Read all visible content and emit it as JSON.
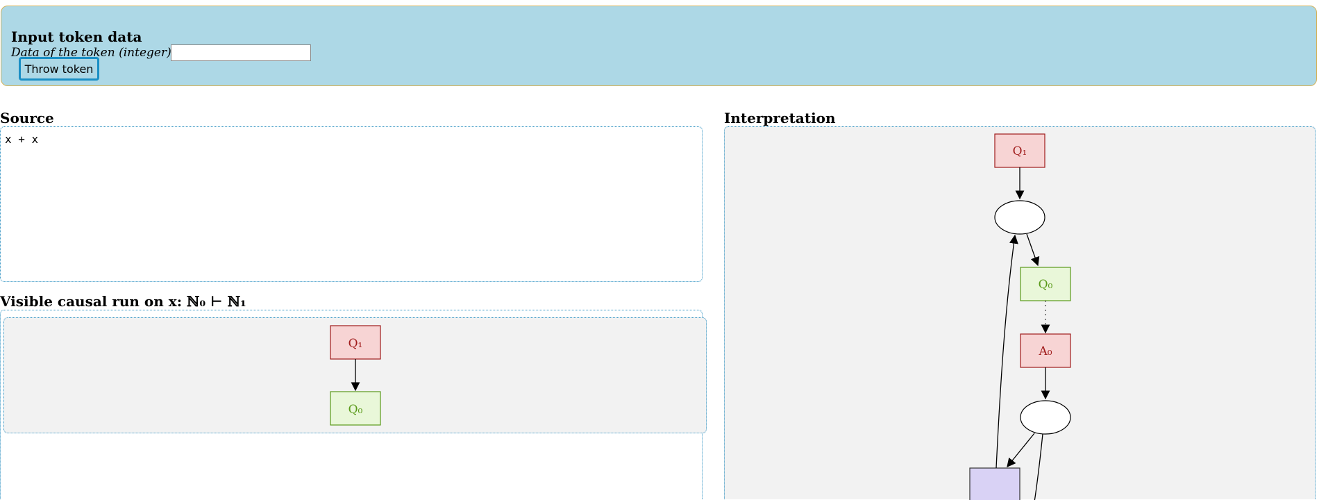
{
  "token_panel": {
    "title": "Input token data",
    "label": "Data of the token (integer):",
    "input_value": "",
    "button_label": "Throw token"
  },
  "source": {
    "title": "Source",
    "code": "x + x"
  },
  "causal_run": {
    "title": "Visible causal run on x: ℕ₀ ⊢ ℕ₁",
    "nodes": {
      "q1": "Q₁",
      "q0": "Q₀"
    }
  },
  "interpretation": {
    "title": "Interpretation",
    "nodes": {
      "q1": "Q₁",
      "q0": "Q₀",
      "a0": "A₀"
    }
  },
  "colors": {
    "panel_bg": "#add8e6",
    "question_fill": "#f7d4d4",
    "question_stroke": "#a01c1c",
    "answer_fill": "#e9f7d9",
    "answer_stroke": "#5a9a1a",
    "box_fill": "#d9d2f5"
  }
}
